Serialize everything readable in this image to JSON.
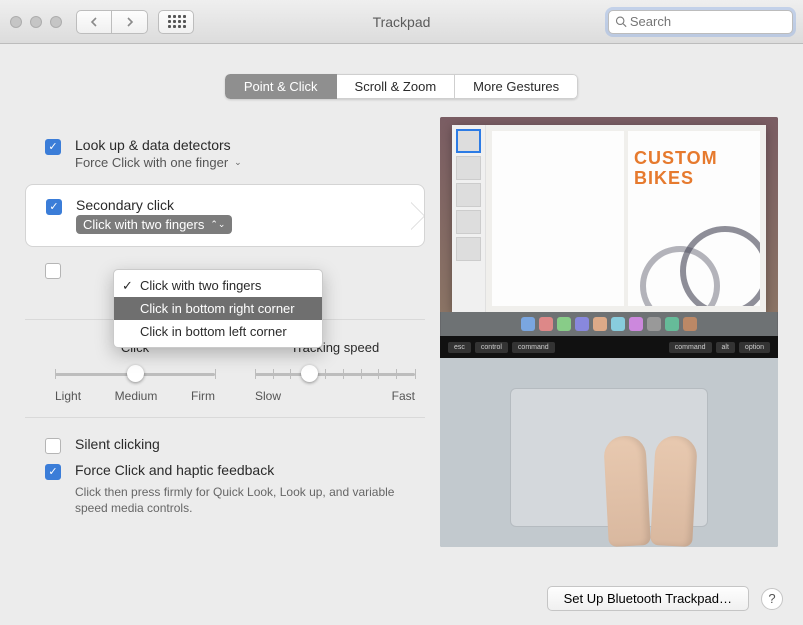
{
  "title": "Trackpad",
  "search_placeholder": "Search",
  "tabs": {
    "t0": "Point & Click",
    "t1": "Scroll & Zoom",
    "t2": "More Gestures"
  },
  "opt_lookup": {
    "title": "Look up & data detectors",
    "sub": "Force Click with one finger"
  },
  "opt_secondary": {
    "title": "Secondary click",
    "sub": "Click with two fingers"
  },
  "popup": {
    "i0": "Click with two fingers",
    "i1": "Click in bottom right corner",
    "i2": "Click in bottom left corner"
  },
  "sliders": {
    "click_title": "Click",
    "click_low": "Light",
    "click_mid": "Medium",
    "click_hi": "Firm",
    "track_title": "Tracking speed",
    "track_low": "Slow",
    "track_hi": "Fast"
  },
  "opt_silent": "Silent clicking",
  "opt_force": {
    "title": "Force Click and haptic feedback",
    "sub": "Click then press firmly for Quick Look, Look up, and variable speed media controls."
  },
  "footer_btn": "Set Up Bluetooth Trackpad…",
  "help": "?",
  "preview": {
    "headline": "CUSTOM BIKES"
  },
  "touchbar": {
    "esc": "esc",
    "cmd": "command",
    "ctrl": "control",
    "opt": "option",
    "alt": "alt"
  }
}
